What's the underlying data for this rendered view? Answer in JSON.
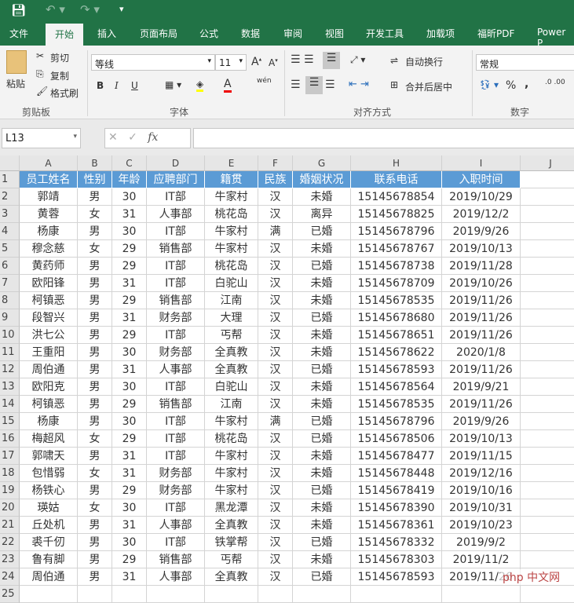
{
  "quick_access": {
    "save_icon": "save-icon",
    "undo_icon": "undo-icon",
    "redo_icon": "redo-icon",
    "customize_icon": "customize-icon"
  },
  "tabs": [
    "文件",
    "开始",
    "插入",
    "页面布局",
    "公式",
    "数据",
    "审阅",
    "视图",
    "开发工具",
    "加载项",
    "福昕PDF",
    "Power P"
  ],
  "active_tab": "开始",
  "ribbon": {
    "clipboard": {
      "paste": "粘贴",
      "cut": "剪切",
      "copy": "复制",
      "format_painter": "格式刷",
      "group": "剪贴板"
    },
    "font": {
      "name": "等线",
      "size": "11",
      "bold": "B",
      "italic": "I",
      "underline": "U",
      "phonetic": "wén",
      "group": "字体",
      "fill_color": "#ffff00",
      "font_color": "#ff0000"
    },
    "alignment": {
      "wrap": "自动换行",
      "merge": "合并后居中",
      "group": "对齐方式"
    },
    "number": {
      "format": "常规",
      "percent": "%",
      "comma": ",",
      "group": "数字"
    }
  },
  "formula_bar": {
    "name_box": "L13",
    "fx": "fx",
    "value": ""
  },
  "columns": [
    "A",
    "B",
    "C",
    "D",
    "E",
    "F",
    "G",
    "H",
    "I",
    "J"
  ],
  "headers": [
    "员工姓名",
    "性别",
    "年龄",
    "应聘部门",
    "籍贯",
    "民族",
    "婚姻状况",
    "联系电话",
    "入职时间"
  ],
  "rows": [
    [
      "郭靖",
      "男",
      "30",
      "IT部",
      "牛家村",
      "汉",
      "未婚",
      "15145678854",
      "2019/10/29"
    ],
    [
      "黄蓉",
      "女",
      "31",
      "人事部",
      "桃花岛",
      "汉",
      "离异",
      "15145678825",
      "2019/12/2"
    ],
    [
      "杨康",
      "男",
      "30",
      "IT部",
      "牛家村",
      "满",
      "已婚",
      "15145678796",
      "2019/9/26"
    ],
    [
      "穆念慈",
      "女",
      "29",
      "销售部",
      "牛家村",
      "汉",
      "未婚",
      "15145678767",
      "2019/10/13"
    ],
    [
      "黄药师",
      "男",
      "29",
      "IT部",
      "桃花岛",
      "汉",
      "已婚",
      "15145678738",
      "2019/11/28"
    ],
    [
      "欧阳锋",
      "男",
      "31",
      "IT部",
      "白驼山",
      "汉",
      "未婚",
      "15145678709",
      "2019/10/26"
    ],
    [
      "柯镇恶",
      "男",
      "29",
      "销售部",
      "江南",
      "汉",
      "未婚",
      "15145678535",
      "2019/11/26"
    ],
    [
      "段智兴",
      "男",
      "31",
      "财务部",
      "大理",
      "汉",
      "已婚",
      "15145678680",
      "2019/11/26"
    ],
    [
      "洪七公",
      "男",
      "29",
      "IT部",
      "丐帮",
      "汉",
      "未婚",
      "15145678651",
      "2019/11/26"
    ],
    [
      "王重阳",
      "男",
      "30",
      "财务部",
      "全真教",
      "汉",
      "未婚",
      "15145678622",
      "2020/1/8"
    ],
    [
      "周伯通",
      "男",
      "31",
      "人事部",
      "全真教",
      "汉",
      "已婚",
      "15145678593",
      "2019/11/26"
    ],
    [
      "欧阳克",
      "男",
      "30",
      "IT部",
      "白驼山",
      "汉",
      "未婚",
      "15145678564",
      "2019/9/21"
    ],
    [
      "柯镇恶",
      "男",
      "29",
      "销售部",
      "江南",
      "汉",
      "未婚",
      "15145678535",
      "2019/11/26"
    ],
    [
      "杨康",
      "男",
      "30",
      "IT部",
      "牛家村",
      "满",
      "已婚",
      "15145678796",
      "2019/9/26"
    ],
    [
      "梅超风",
      "女",
      "29",
      "IT部",
      "桃花岛",
      "汉",
      "已婚",
      "15145678506",
      "2019/10/13"
    ],
    [
      "郭啸天",
      "男",
      "31",
      "IT部",
      "牛家村",
      "汉",
      "未婚",
      "15145678477",
      "2019/11/15"
    ],
    [
      "包惜弱",
      "女",
      "31",
      "财务部",
      "牛家村",
      "汉",
      "未婚",
      "15145678448",
      "2019/12/16"
    ],
    [
      "杨铁心",
      "男",
      "29",
      "财务部",
      "牛家村",
      "汉",
      "已婚",
      "15145678419",
      "2019/10/16"
    ],
    [
      "瑛姑",
      "女",
      "30",
      "IT部",
      "黑龙潭",
      "汉",
      "未婚",
      "15145678390",
      "2019/10/31"
    ],
    [
      "丘处机",
      "男",
      "31",
      "人事部",
      "全真教",
      "汉",
      "未婚",
      "15145678361",
      "2019/10/23"
    ],
    [
      "裘千仞",
      "男",
      "30",
      "IT部",
      "铁掌帮",
      "汉",
      "已婚",
      "15145678332",
      "2019/9/2"
    ],
    [
      "鲁有脚",
      "男",
      "29",
      "销售部",
      "丐帮",
      "汉",
      "未婚",
      "15145678303",
      "2019/11/2"
    ],
    [
      "周伯通",
      "男",
      "31",
      "人事部",
      "全真教",
      "汉",
      "已婚",
      "15145678593",
      "2019/11/26"
    ]
  ],
  "watermark": "php 中文网",
  "colors": {
    "title_bar": "#217346",
    "header_fill": "#5b9bd5"
  }
}
